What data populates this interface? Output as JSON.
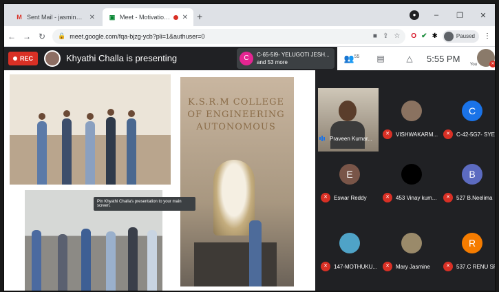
{
  "tabs": [
    {
      "title": "Sent Mail - jasmine@ksrmce.ac.in",
      "icon": "gmail-icon",
      "active": false
    },
    {
      "title": "Meet - Motivational Speech",
      "icon": "meet-icon",
      "active": true
    }
  ],
  "toolbar": {
    "url": "meet.google.com/fqa-bjzg-ycb?pli=1&authuser=0",
    "profile_status": "Paused"
  },
  "meet": {
    "rec_label": "REC",
    "presenting_text": "Khyathi Challa is presenting",
    "chip_initial": "C",
    "chip_line1": "C-65-5I9- YELUGOTI JESH...",
    "chip_line2": "and 53 more",
    "participants_count": "55",
    "time": "5:55 PM",
    "you_label": "You"
  },
  "slide": {
    "sign_text": "K.S.R.M COLLEGE OF ENGINEERING AUTONOMOUS",
    "tooltip": "Pin Khyathi Challa's presentation to your main screen."
  },
  "participants": [
    {
      "name": "Praveen Kumar...",
      "type": "video",
      "muted": false
    },
    {
      "name": "VISHWAKARM...",
      "type": "photo",
      "muted": true,
      "color": "#8a7260"
    },
    {
      "name": "C-42-5G7- SYE...",
      "type": "initial",
      "initial": "C",
      "muted": true,
      "color": "#1a73e8"
    },
    {
      "name": "Eswar Reddy",
      "type": "initial",
      "initial": "E",
      "muted": true,
      "color": "#795548"
    },
    {
      "name": "453 Vinay kum...",
      "type": "blank",
      "muted": true,
      "color": "#000000"
    },
    {
      "name": "527 B.Neelima",
      "type": "initial",
      "initial": "B",
      "muted": true,
      "color": "#5c6bc0"
    },
    {
      "name": "147-MOTHUKU...",
      "type": "photo",
      "muted": true,
      "color": "#4fa3c7"
    },
    {
      "name": "Mary Jasmine",
      "type": "photo",
      "muted": true,
      "color": "#9a8a6a"
    },
    {
      "name": "537.C RENU SRI",
      "type": "initial",
      "initial": "R",
      "muted": true,
      "color": "#f57c00"
    }
  ]
}
